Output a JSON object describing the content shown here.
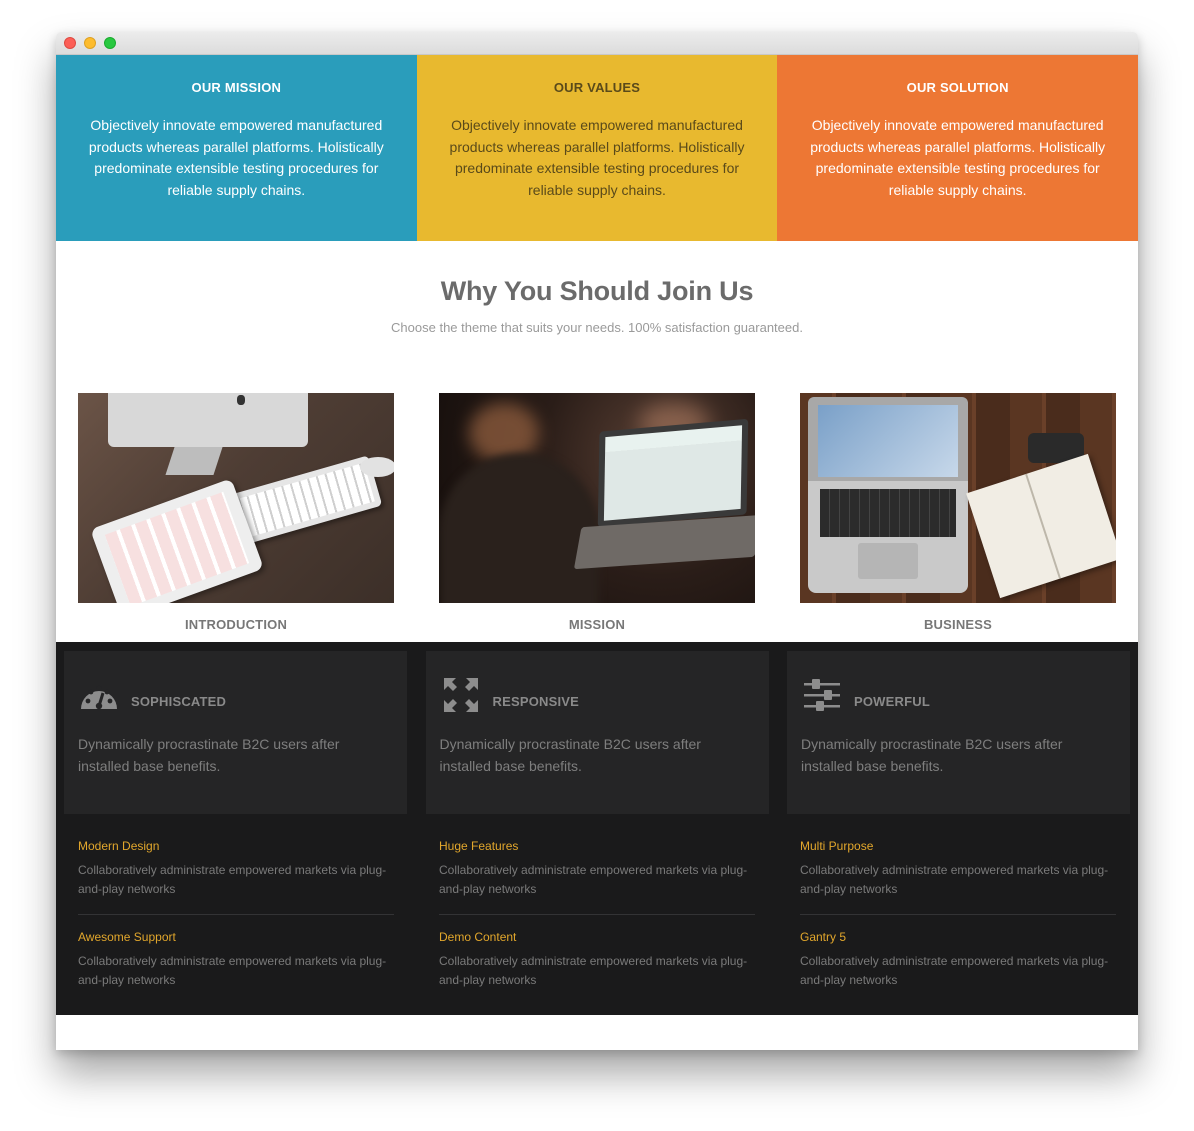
{
  "top": [
    {
      "title": "OUR MISSION",
      "text": "Objectively innovate empowered manufactured products whereas parallel platforms. Holistically predominate extensible testing procedures for reliable supply chains."
    },
    {
      "title": "OUR VALUES",
      "text": "Objectively innovate empowered manufactured products whereas parallel platforms. Holistically predominate extensible testing procedures for reliable supply chains."
    },
    {
      "title": "OUR SOLUTION",
      "text": "Objectively innovate empowered manufactured products whereas parallel platforms. Holistically predominate extensible testing procedures for reliable supply chains."
    }
  ],
  "join": {
    "title": "Why You Should Join Us",
    "subtitle": "Choose the theme that suits your needs. 100% satisfaction guaranteed.",
    "cards": [
      {
        "label": "INTRODUCTION"
      },
      {
        "label": "MISSION"
      },
      {
        "label": "BUSINESS"
      }
    ]
  },
  "features": [
    {
      "title": "SOPHISCATED",
      "icon": "dashboard-icon",
      "text": "Dynamically procrastinate B2C users after installed base benefits."
    },
    {
      "title": "RESPONSIVE",
      "icon": "expand-arrows-icon",
      "text": "Dynamically procrastinate B2C users after installed base benefits."
    },
    {
      "title": "POWERFUL",
      "icon": "sliders-icon",
      "text": "Dynamically procrastinate B2C users after installed base benefits."
    }
  ],
  "lists": [
    [
      {
        "title": "Modern Design",
        "text": "Collaboratively administrate empowered markets via plug-and-play networks"
      },
      {
        "title": "Awesome Support",
        "text": "Collaboratively administrate empowered markets via plug-and-play networks"
      }
    ],
    [
      {
        "title": "Huge Features",
        "text": "Collaboratively administrate empowered markets via plug-and-play networks"
      },
      {
        "title": "Demo Content",
        "text": "Collaboratively administrate empowered markets via plug-and-play networks"
      }
    ],
    [
      {
        "title": "Multi Purpose",
        "text": "Collaboratively administrate empowered markets via plug-and-play networks"
      },
      {
        "title": "Gantry 5",
        "text": "Collaboratively administrate empowered markets via plug-and-play networks"
      }
    ]
  ],
  "colors": {
    "blue": "#2a9dbb",
    "yellow": "#e8b92f",
    "orange": "#ed7734",
    "accent": "#e2a72c",
    "dark": "#1a1a1b"
  }
}
